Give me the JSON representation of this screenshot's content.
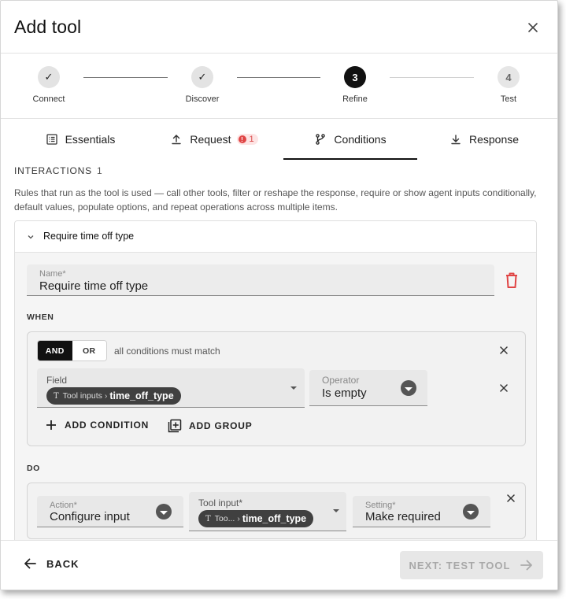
{
  "dialog": {
    "title": "Add tool"
  },
  "stepper": {
    "steps": [
      {
        "label": "Connect",
        "marker": "✓",
        "state": "done"
      },
      {
        "label": "Discover",
        "marker": "✓",
        "state": "done"
      },
      {
        "label": "Refine",
        "marker": "3",
        "state": "active"
      },
      {
        "label": "Test",
        "marker": "4",
        "state": "todo"
      }
    ]
  },
  "tabs": [
    {
      "label": "Essentials",
      "icon": "list-icon"
    },
    {
      "label": "Request",
      "icon": "upload-icon",
      "badge": "1",
      "badge_icon": "!"
    },
    {
      "label": "Conditions",
      "icon": "branch-icon",
      "active": true
    },
    {
      "label": "Response",
      "icon": "download-icon"
    }
  ],
  "interactions": {
    "title": "INTERACTIONS",
    "count": "1",
    "description": "Rules that run as the tool is used — call other tools, filter or reshape the response, require or show agent inputs conditionally, default values, populate options, and repeat operations across multiple items.",
    "rule": {
      "header": "Require time off type",
      "name_label": "Name*",
      "name_value": "Require time off type",
      "when": {
        "label": "WHEN",
        "and_label": "AND",
        "or_label": "OR",
        "match_text": "all conditions must match",
        "condition": {
          "field_label": "Field",
          "field_chip_prefix": "Tool inputs",
          "field_chip_value": "time_off_type",
          "operator_label": "Operator",
          "operator_value": "Is empty"
        },
        "add_condition_label": "ADD CONDITION",
        "add_group_label": "ADD GROUP"
      },
      "do": {
        "label": "DO",
        "action_label": "Action*",
        "action_value": "Configure input",
        "tool_input_label": "Tool input*",
        "tool_input_chip_prefix": "Too...",
        "tool_input_chip_value": "time_off_type",
        "setting_label": "Setting*",
        "setting_value": "Make required"
      }
    }
  },
  "footer": {
    "back_label": "BACK",
    "next_label": "NEXT: TEST TOOL"
  },
  "colors": {
    "accent": "#111111",
    "danger": "#e04545",
    "disabled_text": "#a8a8a8"
  }
}
